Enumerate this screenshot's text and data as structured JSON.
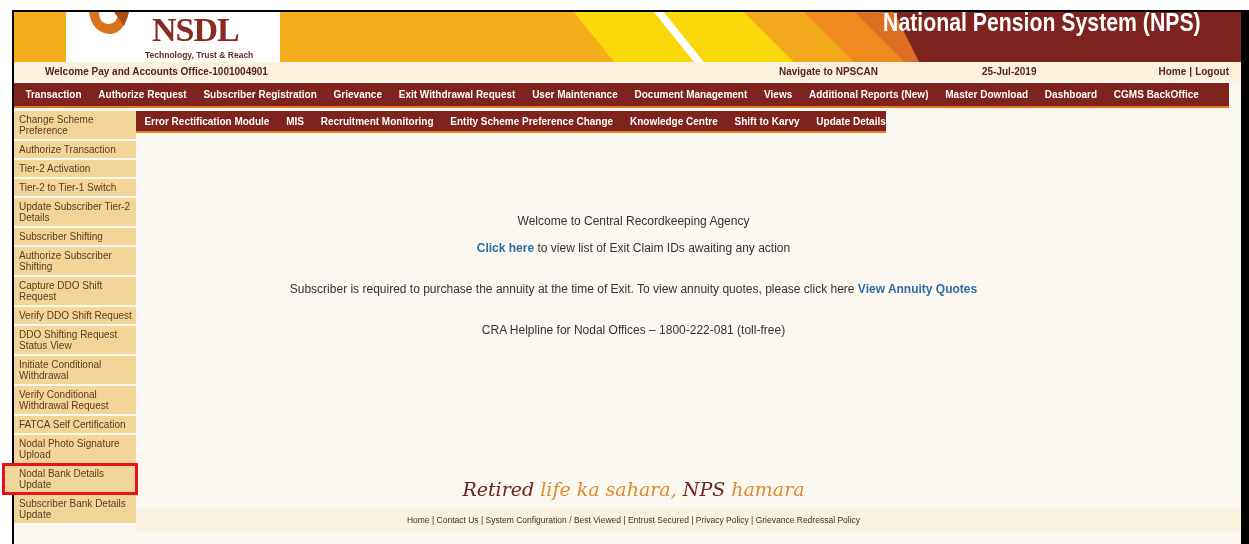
{
  "header": {
    "logo_text": "NSDL",
    "tagline": "Technology, Trust & Reach",
    "title": "National Pension System (NPS)"
  },
  "top_bar": {
    "welcome": "Welcome Pay and Accounts Office-1001004901",
    "navigate": "Navigate to NPSCAN",
    "date": "25-Jul-2019",
    "links": [
      "Home",
      "Logout"
    ],
    "separator": "|"
  },
  "main_nav": [
    "Transaction",
    "Authorize Request",
    "Subscriber Registration",
    "Grievance",
    "Exit Withdrawal Request",
    "User Maintenance",
    "Document Management",
    "Views",
    "Additional Reports (New)",
    "Master Download",
    "Dashboard",
    "CGMS BackOffice"
  ],
  "sub_nav": [
    "Error Rectification Module",
    "MIS",
    "Recruitment Monitoring",
    "Entity Scheme Preference Change",
    "Knowledge Centre",
    "Shift to Karvy",
    "Update Details"
  ],
  "sidebar": {
    "items": [
      {
        "label": "Change Scheme Preference",
        "highlighted": false
      },
      {
        "label": "Authorize Transaction",
        "highlighted": false
      },
      {
        "label": "Tier-2 Activation",
        "highlighted": false
      },
      {
        "label": "Tier-2 to Tier-1 Switch",
        "highlighted": false
      },
      {
        "label": "Update Subscriber Tier-2 Details",
        "highlighted": false
      },
      {
        "label": "Subscriber Shifting",
        "highlighted": false
      },
      {
        "label": "Authorize Subscriber Shifting",
        "highlighted": false
      },
      {
        "label": "Capture DDO Shift Request",
        "highlighted": false
      },
      {
        "label": "Verify DDO Shift Request",
        "highlighted": false
      },
      {
        "label": "DDO Shifting Request Status View",
        "highlighted": false
      },
      {
        "label": "Initiate Conditional Withdrawal",
        "highlighted": false
      },
      {
        "label": "Verify Conditional Withdrawal Request",
        "highlighted": false
      },
      {
        "label": "FATCA Self Certification",
        "highlighted": false
      },
      {
        "label": "Nodal Photo Signature Upload",
        "highlighted": false
      },
      {
        "label": "Nodal Bank Details Update",
        "highlighted": true
      },
      {
        "label": "Subscriber Bank Details Update",
        "highlighted": false
      }
    ]
  },
  "content": {
    "welcome": "Welcome to Central Recordkeeping Agency",
    "exit_link": "Click here",
    "exit_text": "to view list of Exit Claim IDs awaiting any action",
    "annuity_text": "Subscriber is required to purchase the annuity at the time of Exit. To view annuity quotes, please click here",
    "annuity_link": "View Annuity Quotes",
    "helpline": "CRA Helpline for Nodal Offices – 1800-222-081 (toll-free)"
  },
  "slogan": [
    {
      "text": "Retired",
      "color": "#6b2418"
    },
    {
      "text": "life ka sahara,",
      "color": "#e08a2c"
    },
    {
      "text": "NPS",
      "color": "#6b2418"
    },
    {
      "text": "hamara",
      "color": "#e08a2c"
    }
  ],
  "footer": {
    "links": [
      "Home",
      "Contact Us",
      "System Configuration / Best Viewed",
      "Entrust Secured",
      "Privacy Policy",
      "Grievance Redressal Policy"
    ],
    "separator": "|"
  }
}
